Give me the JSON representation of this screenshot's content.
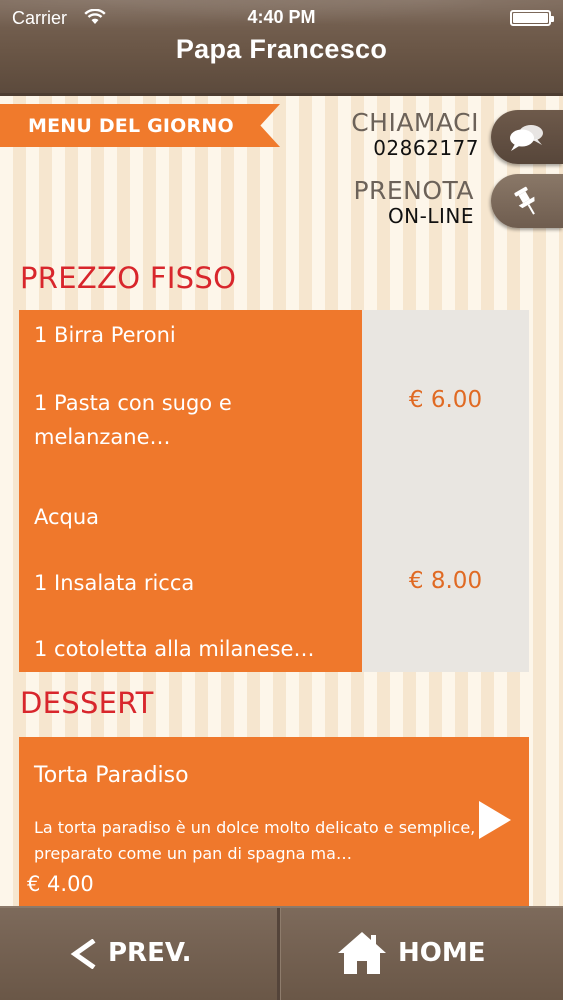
{
  "status_bar": {
    "carrier": "Carrier",
    "time": "4:40 PM"
  },
  "header": {
    "title": "Papa Francesco"
  },
  "menu_ribbon": {
    "label": "MENU DEL GIORNO"
  },
  "call": {
    "title": "CHIAMACI",
    "number": "02862177",
    "icon": "speech-bubbles-icon"
  },
  "booking": {
    "title": "PRENOTA",
    "subtitle": "ON-LINE",
    "icon": "pushpin-icon"
  },
  "sections": {
    "fixed_price": "PREZZO FISSO",
    "dessert": "DESSERT"
  },
  "fixed_menus": [
    {
      "items": [
        "1 Birra Peroni",
        "1 Pasta con sugo e",
        "melanzane…"
      ],
      "price": "€ 6.00"
    },
    {
      "items": [
        "Acqua",
        "1 Insalata ricca",
        "1 cotoletta alla milanese…"
      ],
      "price": "€ 8.00"
    }
  ],
  "desserts": [
    {
      "name": "Torta Paradiso",
      "description": "La torta paradiso è un dolce molto delicato e semplice, preparato come un pan di spagna ma…",
      "price": "€ 4.00"
    }
  ],
  "bottom_nav": {
    "prev_label": "PREV.",
    "home_label": "HOME"
  },
  "colors": {
    "accent": "#ef782c",
    "heading": "#d8262c",
    "bar": "#6a5646",
    "price_bg": "#e9e6e1"
  }
}
